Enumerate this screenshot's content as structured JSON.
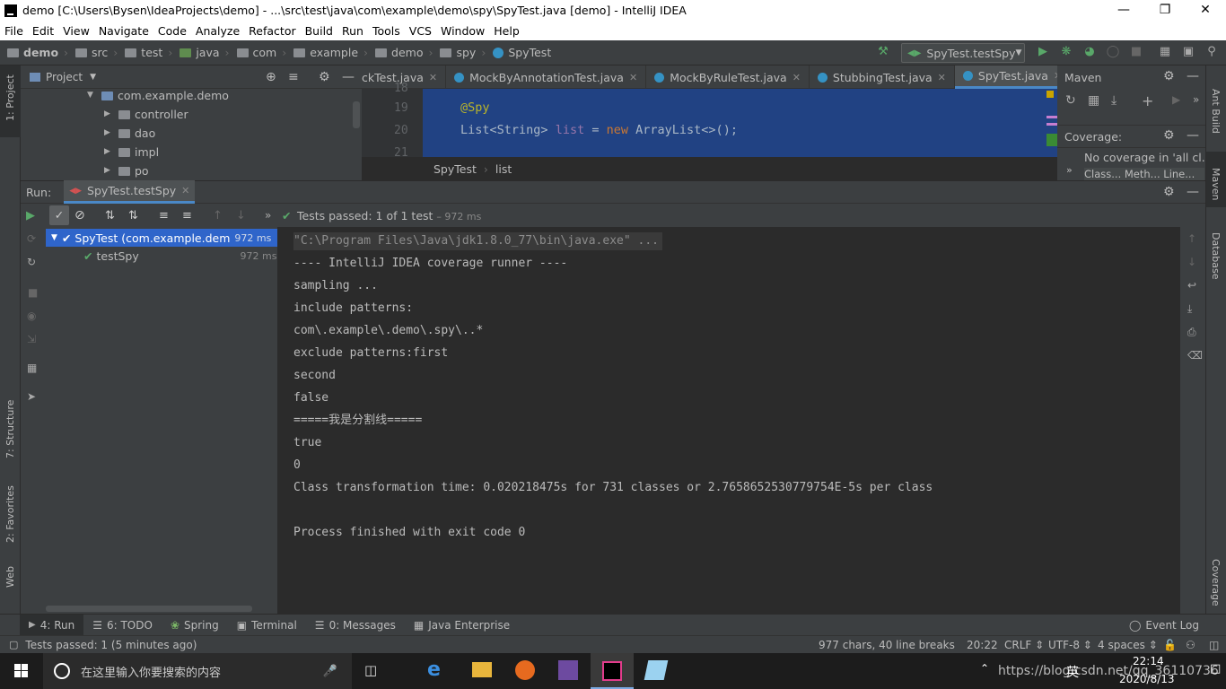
{
  "window": {
    "title": "demo [C:\\Users\\Bysen\\IdeaProjects\\demo] - ...\\src\\test\\java\\com\\example\\demo\\spy\\SpyTest.java [demo] - IntelliJ IDEA"
  },
  "menu": [
    "File",
    "Edit",
    "View",
    "Navigate",
    "Code",
    "Analyze",
    "Refactor",
    "Build",
    "Run",
    "Tools",
    "VCS",
    "Window",
    "Help"
  ],
  "breadcrumbs": [
    "demo",
    "src",
    "test",
    "java",
    "com",
    "example",
    "demo",
    "spy",
    "SpyTest"
  ],
  "run_config": "SpyTest.testSpy",
  "project_panel": {
    "title": "Project",
    "tree": [
      {
        "label": "com.example.demo"
      },
      {
        "label": "controller"
      },
      {
        "label": "dao"
      },
      {
        "label": "impl"
      },
      {
        "label": "po"
      }
    ]
  },
  "editor": {
    "tabs": [
      {
        "label": "ckTest.java",
        "active": false
      },
      {
        "label": "MockByAnnotationTest.java",
        "active": false
      },
      {
        "label": "MockByRuleTest.java",
        "active": false
      },
      {
        "label": "StubbingTest.java",
        "active": false
      },
      {
        "label": "SpyTest.java",
        "active": true
      }
    ],
    "tab_overflow": "≡3",
    "lines": [
      {
        "num": "19",
        "annotation": "@Spy"
      },
      {
        "num": "20",
        "type": "List<String>",
        "var": "list",
        "eq": "=",
        "kw": "new",
        "ctor": "ArrayList<>();"
      },
      {
        "num": "21"
      }
    ],
    "crumbs": [
      "SpyTest",
      "list"
    ]
  },
  "maven_panel": {
    "title": "Maven",
    "coverage_title": "Coverage:",
    "coverage_text": "No coverage in 'all cl...",
    "coverage_cols": "Class... Meth... Line..."
  },
  "run_panel": {
    "label": "Run:",
    "config_tab": "SpyTest.testSpy",
    "status": "Tests passed:",
    "status_count": "1 of 1 test",
    "status_time": "– 972 ms",
    "tests": [
      {
        "name": "SpyTest (com.example.demo.s",
        "time": "972 ms"
      },
      {
        "name": "testSpy",
        "time": "972 ms"
      }
    ],
    "console": [
      "\"C:\\Program Files\\Java\\jdk1.8.0_77\\bin\\java.exe\" ...",
      "---- IntelliJ IDEA coverage runner ----",
      "sampling ...",
      "include patterns:",
      "com\\.example\\.demo\\.spy\\..*",
      "exclude patterns:first",
      "second",
      "false",
      "=====我是分割线=====",
      "true",
      "0",
      "Class transformation time: 0.020218475s for 731 classes or 2.7658652530779754E-5s per class",
      "",
      "Process finished with exit code 0"
    ]
  },
  "left_strip": [
    "1: Project",
    "7: Structure",
    "2: Favorites",
    "Web"
  ],
  "right_strip": [
    "Ant Build",
    "Maven",
    "Database",
    "Coverage"
  ],
  "bottom_tabs": [
    "4: Run",
    "6: TODO",
    "Spring",
    "Terminal",
    "0: Messages",
    "Java Enterprise"
  ],
  "event_log": "Event Log",
  "status_bar": {
    "message": "Tests passed: 1 (5 minutes ago)",
    "chars": "977 chars, 40 line breaks",
    "position": "20:22",
    "line_sep": "CRLF",
    "encoding": "UTF-8",
    "indent": "4 spaces"
  },
  "taskbar": {
    "search_placeholder": "在这里输入你要搜索的内容",
    "ime": "英",
    "watermark": "https://blog.csdn.net/qq_36110736",
    "time": "22:14",
    "date": "2020/8/13"
  }
}
